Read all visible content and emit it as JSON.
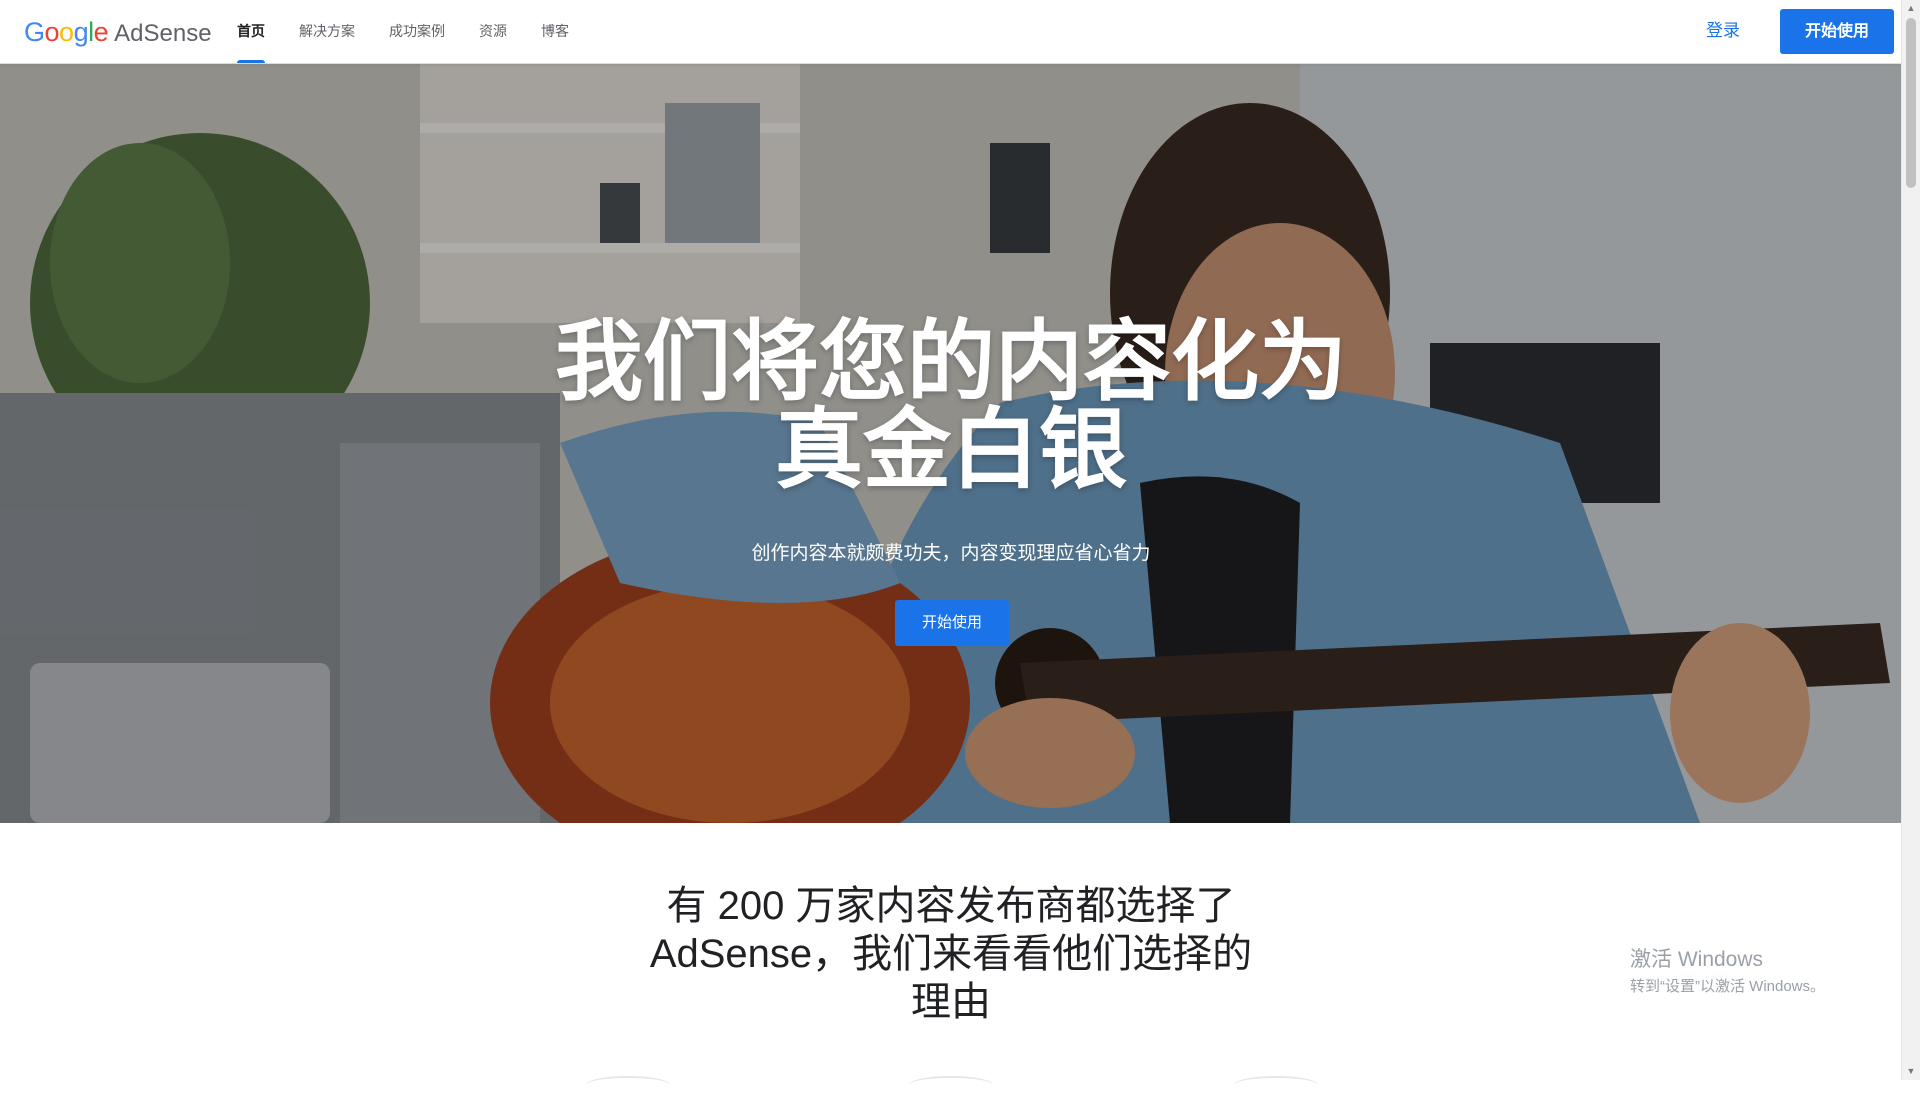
{
  "header": {
    "logo_letters": [
      {
        "char": "G",
        "color": "#4285F4"
      },
      {
        "char": "o",
        "color": "#EA4335"
      },
      {
        "char": "o",
        "color": "#FBBC05"
      },
      {
        "char": "g",
        "color": "#4285F4"
      },
      {
        "char": "l",
        "color": "#34A853"
      },
      {
        "char": "e",
        "color": "#EA4335"
      }
    ],
    "logo_google": "Google",
    "logo_product": "AdSense",
    "nav": [
      {
        "label": "首页",
        "active": true
      },
      {
        "label": "解决方案",
        "active": false
      },
      {
        "label": "成功案例",
        "active": false
      },
      {
        "label": "资源",
        "active": false
      },
      {
        "label": "博客",
        "active": false
      }
    ],
    "signin_label": "登录",
    "start_label": "开始使用"
  },
  "hero": {
    "title_line1": "我们将您的内容化为",
    "title_line2": "真金白银",
    "subtitle": "创作内容本就颇费功夫，内容变现理应省心省力",
    "cta_label": "开始使用"
  },
  "section": {
    "title_line1": "有 200 万家内容发布商都选择了",
    "title_line2": "AdSense，我们来看看他们选择的",
    "title_line3": "理由"
  },
  "windows_watermark": {
    "line1": "激活 Windows",
    "line2": "转到“设置”以激活 Windows。"
  },
  "colors": {
    "accent": "#1a73e8",
    "nav_active": "#202124",
    "nav_inactive": "#5f6368"
  },
  "icons": {
    "scroll_up": "triangle-up",
    "scroll_down": "triangle-down"
  }
}
